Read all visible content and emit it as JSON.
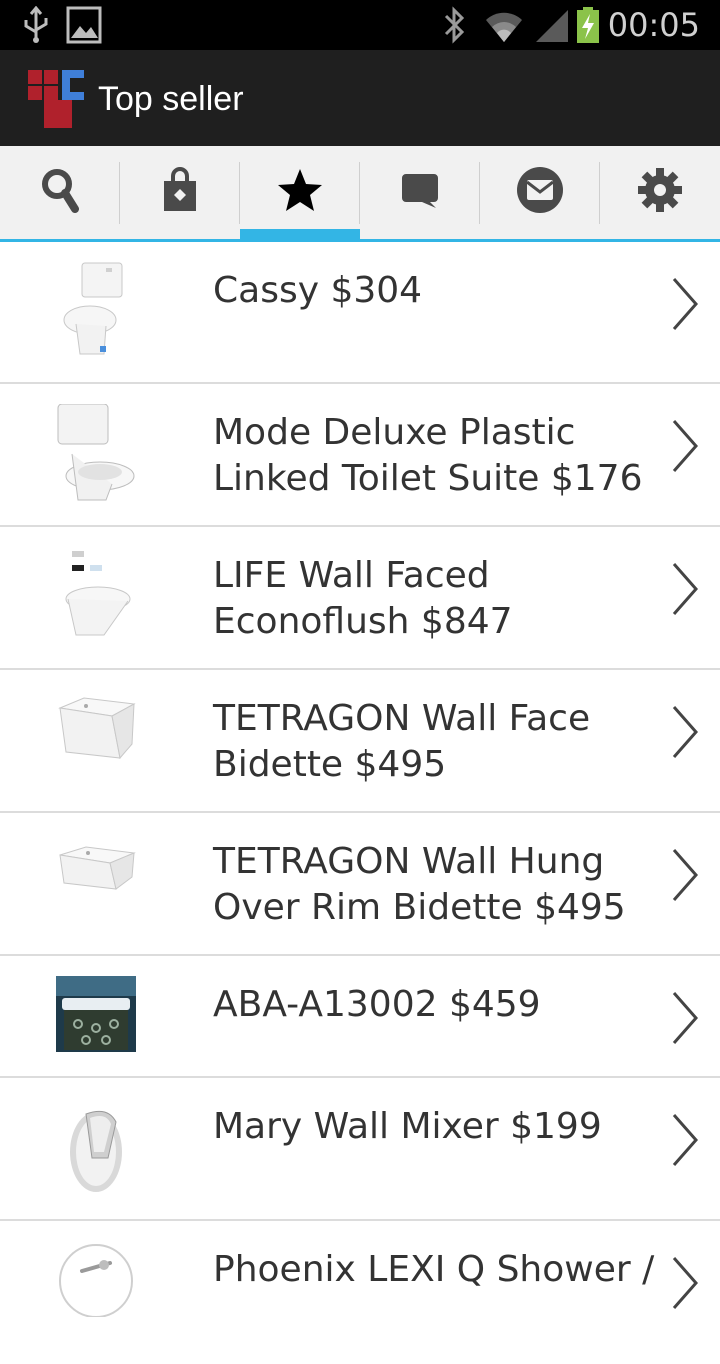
{
  "status_bar": {
    "time": "00:05",
    "icons": [
      "usb-icon",
      "image-icon",
      "bluetooth-icon",
      "wifi-icon",
      "signal-icon",
      "battery-charging-icon"
    ]
  },
  "action_bar": {
    "title": "Top seller"
  },
  "tabs": [
    {
      "icon": "search-icon"
    },
    {
      "icon": "shopping-bag-icon"
    },
    {
      "icon": "star-icon",
      "active": true
    },
    {
      "icon": "chat-icon"
    },
    {
      "icon": "mail-icon"
    },
    {
      "icon": "settings-icon"
    }
  ],
  "products": [
    {
      "label": "Cassy $304"
    },
    {
      "label": "Mode Deluxe Plastic Linked Toilet Suite $176"
    },
    {
      "label": "LIFE Wall Faced Econoflush $847"
    },
    {
      "label": "TETRAGON Wall Face Bidette $495"
    },
    {
      "label": "TETRAGON Wall Hung Over Rim Bidette $495"
    },
    {
      "label": "ABA-A13002 $459"
    },
    {
      "label": "Mary Wall Mixer $199"
    },
    {
      "label": "Phoenix LEXI Q Shower /"
    }
  ],
  "colors": {
    "accent": "#33b5e5",
    "action_bar": "#1f1f1f",
    "status_bar": "#000000"
  }
}
